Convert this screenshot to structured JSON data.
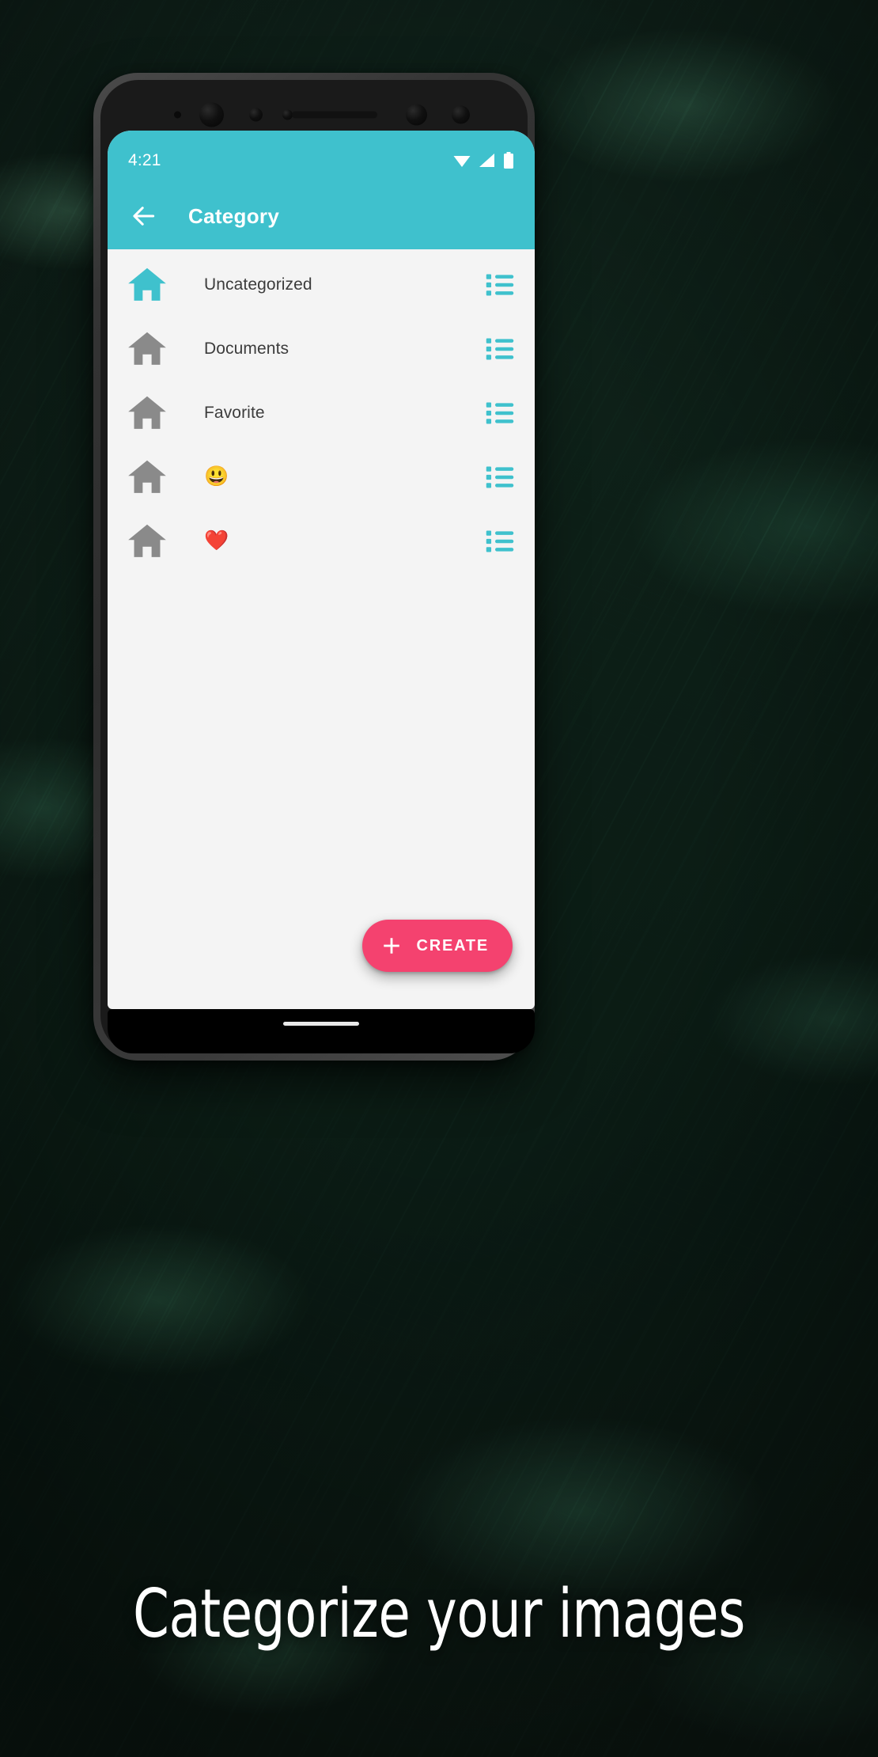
{
  "app": {
    "statusbar": {
      "clock": "4:21",
      "icons": [
        "wifi-icon",
        "signal-icon",
        "battery-icon"
      ]
    },
    "appbar": {
      "back_icon": "back-arrow-icon",
      "title": "Category"
    },
    "list": {
      "items": [
        {
          "label": "Uncategorized",
          "leading_icon": "home-icon",
          "leading_color": "#3fc1cd",
          "trailing_icon": "list-icon",
          "is_emoji": false
        },
        {
          "label": "Documents",
          "leading_icon": "home-icon",
          "leading_color": "#8a8a8a",
          "trailing_icon": "list-icon",
          "is_emoji": false
        },
        {
          "label": "Favorite",
          "leading_icon": "home-icon",
          "leading_color": "#8a8a8a",
          "trailing_icon": "list-icon",
          "is_emoji": false
        },
        {
          "label": "😃",
          "leading_icon": "home-icon",
          "leading_color": "#8a8a8a",
          "trailing_icon": "list-icon",
          "is_emoji": true
        },
        {
          "label": "❤️",
          "leading_icon": "home-icon",
          "leading_color": "#8a8a8a",
          "trailing_icon": "list-icon",
          "is_emoji": true
        }
      ]
    },
    "fab": {
      "icon": "plus-icon",
      "label": "CREATE"
    }
  },
  "caption": "Categorize your images",
  "colors": {
    "primary_teal": "#3fc1cd",
    "accent_pink": "#f4426f",
    "screen_bg": "#f4f4f4",
    "icon_gray": "#8a8a8a",
    "text_dark": "#3c3c3c",
    "white": "#ffffff"
  }
}
